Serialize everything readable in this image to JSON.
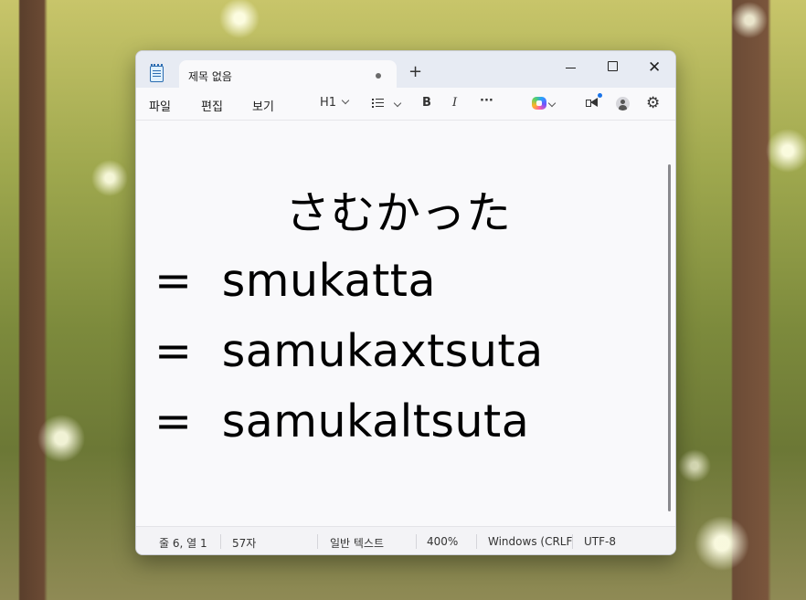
{
  "window": {
    "tab_title": "제목 없음",
    "new_tab_label": "+",
    "minimize_label": "minimize",
    "maximize_label": "maximize",
    "close_label": "✕"
  },
  "menu": {
    "file": "파일",
    "edit": "편집",
    "view": "보기"
  },
  "toolbar": {
    "heading": "H1",
    "bold": "B",
    "italic": "I",
    "more": "···",
    "icons": [
      "list-icon",
      "copilot-icon",
      "announcement-icon",
      "account-icon",
      "settings-gear-icon"
    ]
  },
  "document": {
    "lines": [
      "さむかった",
      "=  smukatta",
      "=  samukaxtsuta",
      "=  samukaltsuta"
    ]
  },
  "status": {
    "position": "줄 6, 열 1",
    "char_count": "57자",
    "format": "일반 텍스트",
    "zoom": "400%",
    "line_ending": "Windows (CRLF",
    "encoding": "UTF-8"
  }
}
